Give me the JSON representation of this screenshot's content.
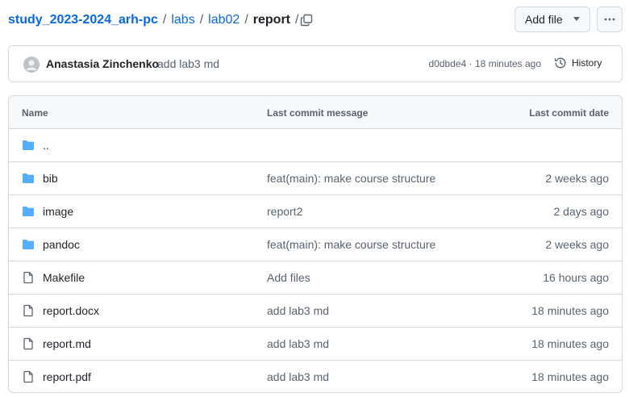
{
  "breadcrumb": {
    "repo": "study_2023-2024_arh-pc",
    "parts": [
      "labs",
      "lab02"
    ],
    "current": "report",
    "separator": "/"
  },
  "actions": {
    "add_file_label": "Add file",
    "more_icon": "kebab-horizontal-icon"
  },
  "commit": {
    "author": "Anastasia Zinchenko",
    "message": "add lab3 md",
    "sha": "d0dbde4",
    "separator": "·",
    "time": "18 minutes ago",
    "history_label": "History"
  },
  "table": {
    "headers": {
      "name": "Name",
      "message": "Last commit message",
      "date": "Last commit date"
    },
    "parent_label": "..",
    "rows": [
      {
        "name": "bib",
        "type": "folder",
        "message": "feat(main): make course structure",
        "date": "2 weeks ago"
      },
      {
        "name": "image",
        "type": "folder",
        "message": "report2",
        "date": "2 days ago"
      },
      {
        "name": "pandoc",
        "type": "folder",
        "message": "feat(main): make course structure",
        "date": "2 weeks ago"
      },
      {
        "name": "Makefile",
        "type": "file",
        "message": "Add files",
        "date": "16 hours ago"
      },
      {
        "name": "report.docx",
        "type": "file",
        "message": "add lab3 md",
        "date": "18 minutes ago"
      },
      {
        "name": "report.md",
        "type": "file",
        "message": "add lab3 md",
        "date": "18 minutes ago"
      },
      {
        "name": "report.pdf",
        "type": "file",
        "message": "add lab3 md",
        "date": "18 minutes ago"
      }
    ]
  },
  "colors": {
    "link": "#0969da",
    "folder": "#54aeff",
    "muted": "#59636e",
    "border": "#d1d9e0"
  }
}
